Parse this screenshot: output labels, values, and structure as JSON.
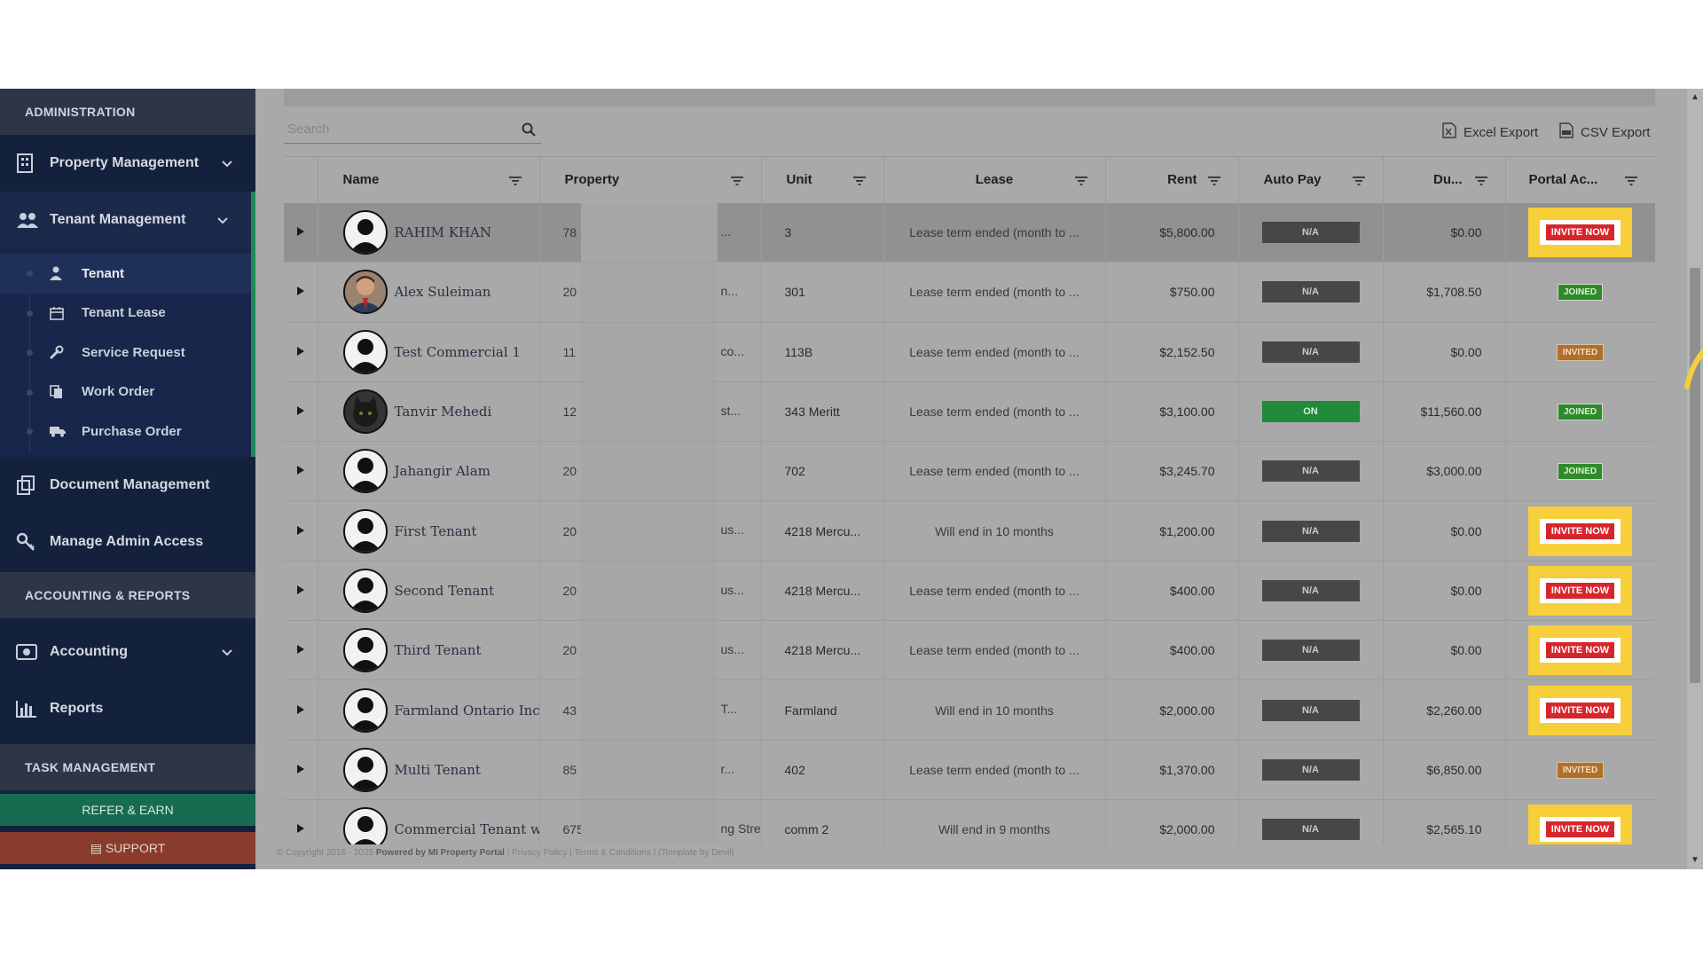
{
  "sidebar": {
    "section_admin": "ADMINISTRATION",
    "property_management": "Property Management",
    "tenant_management": "Tenant Management",
    "sub": {
      "tenant": "Tenant",
      "tenant_lease": "Tenant Lease",
      "service_request": "Service Request",
      "work_order": "Work Order",
      "purchase_order": "Purchase Order"
    },
    "document_management": "Document Management",
    "manage_admin_access": "Manage Admin Access",
    "section_accounting": "ACCOUNTING & REPORTS",
    "accounting": "Accounting",
    "reports": "Reports",
    "section_task": "TASK MANAGEMENT",
    "refer": "REFER & EARN",
    "support": "SUPPORT"
  },
  "toolbar": {
    "search_placeholder": "Search",
    "excel_export": "Excel Export",
    "csv_export": "CSV Export"
  },
  "columns": {
    "name": "Name",
    "property": "Property",
    "unit": "Unit",
    "lease": "Lease",
    "rent": "Rent",
    "autopay": "Auto Pay",
    "due": "Du...",
    "portal": "Portal Ac..."
  },
  "rows": [
    {
      "name": "RAHIM KHAN",
      "prop_start": "78",
      "prop_end": "...",
      "unit": "3",
      "lease": "Lease term ended (month to ...",
      "rent": "$5,800.00",
      "autopay": "N/A",
      "due": "$0.00",
      "portal": "INVITE NOW"
    },
    {
      "name": "Alex Suleiman",
      "prop_start": "20",
      "prop_end": "n...",
      "unit": "301",
      "lease": "Lease term ended (month to ...",
      "rent": "$750.00",
      "autopay": "N/A",
      "due": "$1,708.50",
      "portal": "JOINED"
    },
    {
      "name": "Test Commercial 1",
      "prop_start": "11",
      "prop_end": "co...",
      "unit": "113B",
      "lease": "Lease term ended (month to ...",
      "rent": "$2,152.50",
      "autopay": "N/A",
      "due": "$0.00",
      "portal": "INVITED"
    },
    {
      "name": "Tanvir Mehedi",
      "prop_start": "12",
      "prop_end": "st...",
      "unit": "343 Meritt",
      "lease": "Lease term ended (month to ...",
      "rent": "$3,100.00",
      "autopay": "ON",
      "due": "$11,560.00",
      "portal": "JOINED"
    },
    {
      "name": "Jahangir Alam",
      "prop_start": "20",
      "prop_end": "",
      "unit": "702",
      "lease": "Lease term ended (month to ...",
      "rent": "$3,245.70",
      "autopay": "N/A",
      "due": "$3,000.00",
      "portal": "JOINED"
    },
    {
      "name": "First Tenant",
      "prop_start": "20",
      "prop_end": "us...",
      "unit": "4218 Mercu...",
      "lease": "Will end in 10 months",
      "rent": "$1,200.00",
      "autopay": "N/A",
      "due": "$0.00",
      "portal": "INVITE NOW"
    },
    {
      "name": "Second Tenant",
      "prop_start": "20",
      "prop_end": "us...",
      "unit": "4218 Mercu...",
      "lease": "Lease term ended (month to ...",
      "rent": "$400.00",
      "autopay": "N/A",
      "due": "$0.00",
      "portal": "INVITE NOW"
    },
    {
      "name": "Third Tenant",
      "prop_start": "20",
      "prop_end": "us...",
      "unit": "4218 Mercu...",
      "lease": "Lease term ended (month to ...",
      "rent": "$400.00",
      "autopay": "N/A",
      "due": "$0.00",
      "portal": "INVITE NOW"
    },
    {
      "name": "Farmland Ontario Inc",
      "prop_start": "43",
      "prop_end": "T...",
      "unit": "Farmland",
      "lease": "Will end in 10 months",
      "rent": "$2,000.00",
      "autopay": "N/A",
      "due": "$2,260.00",
      "portal": "INVITE NOW"
    },
    {
      "name": "Multi Tenant",
      "prop_start": "85",
      "prop_end": "r...",
      "unit": "402",
      "lease": "Lease term ended (month to ...",
      "rent": "$1,370.00",
      "autopay": "N/A",
      "due": "$6,850.00",
      "portal": "INVITED"
    },
    {
      "name": "Commercial Tenant wit",
      "prop_start": "675",
      "prop_end": "ng Street (New Brunswi...",
      "unit": "comm 2",
      "lease": "Will end in 9 months",
      "rent": "$2,000.00",
      "autopay": "N/A",
      "due": "$2,565.10",
      "portal": "INVITE NOW"
    }
  ],
  "footer": {
    "copyright": "© Copyright 2016 - 2025",
    "powered": "Powered by MI Property Portal",
    "links": "| Privacy Policy | Terms & Conditions |",
    "template": "(Template by Devil)"
  },
  "colors": {
    "sidebar_bg": "#14213d",
    "accent_green": "#1f8a57",
    "invite_red": "#d6262c",
    "highlight_yellow": "#f6cf3a"
  }
}
